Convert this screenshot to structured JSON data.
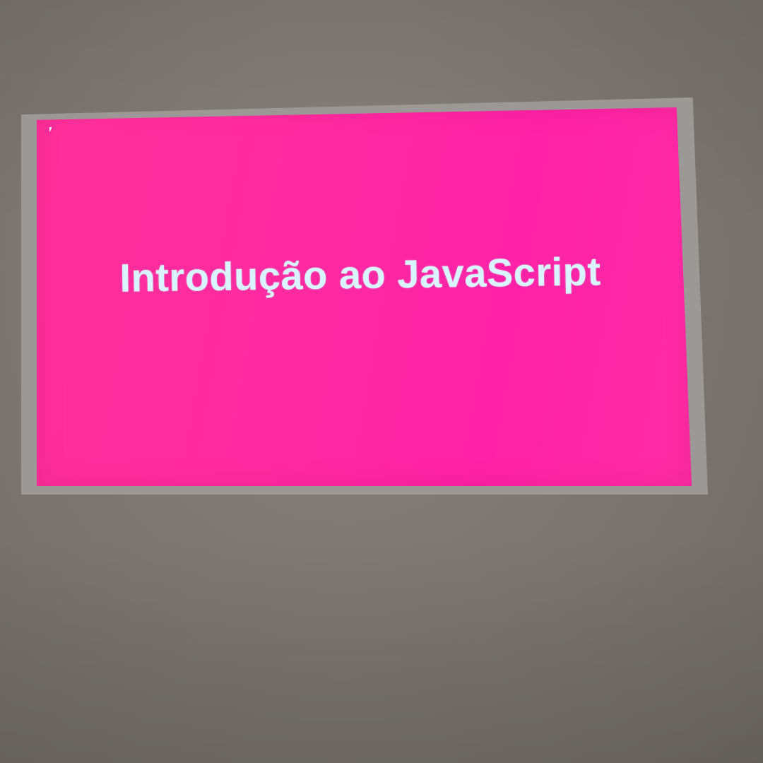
{
  "slide": {
    "title": "Introdução ao JavaScript"
  },
  "colors": {
    "slide_background": "#ff2aa0",
    "title_text": "#d9f3ff",
    "projection_border": "#9c9896",
    "wall": "#7e7872"
  },
  "icons": {
    "cursor": "mouse-pointer-icon"
  }
}
